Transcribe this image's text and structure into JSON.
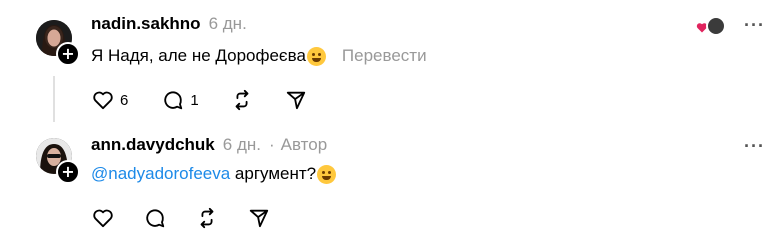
{
  "comments": [
    {
      "username": "nadin.sakhno",
      "time": "6 дн.",
      "text": "Я Надя, але не Дорофеєва",
      "translate": "Перевести",
      "likes": "6",
      "replies": "1"
    },
    {
      "username": "ann.davydchuk",
      "time": "6 дн.",
      "separator": "·",
      "author_label": "Автор",
      "mention": "@nadyadorofeeva",
      "text": " аргумент?"
    }
  ],
  "icons": {
    "follow": "+",
    "more": "···"
  },
  "colors": {
    "mention": "#1d8ae8",
    "muted": "#999999",
    "heart": "#e0245e"
  }
}
